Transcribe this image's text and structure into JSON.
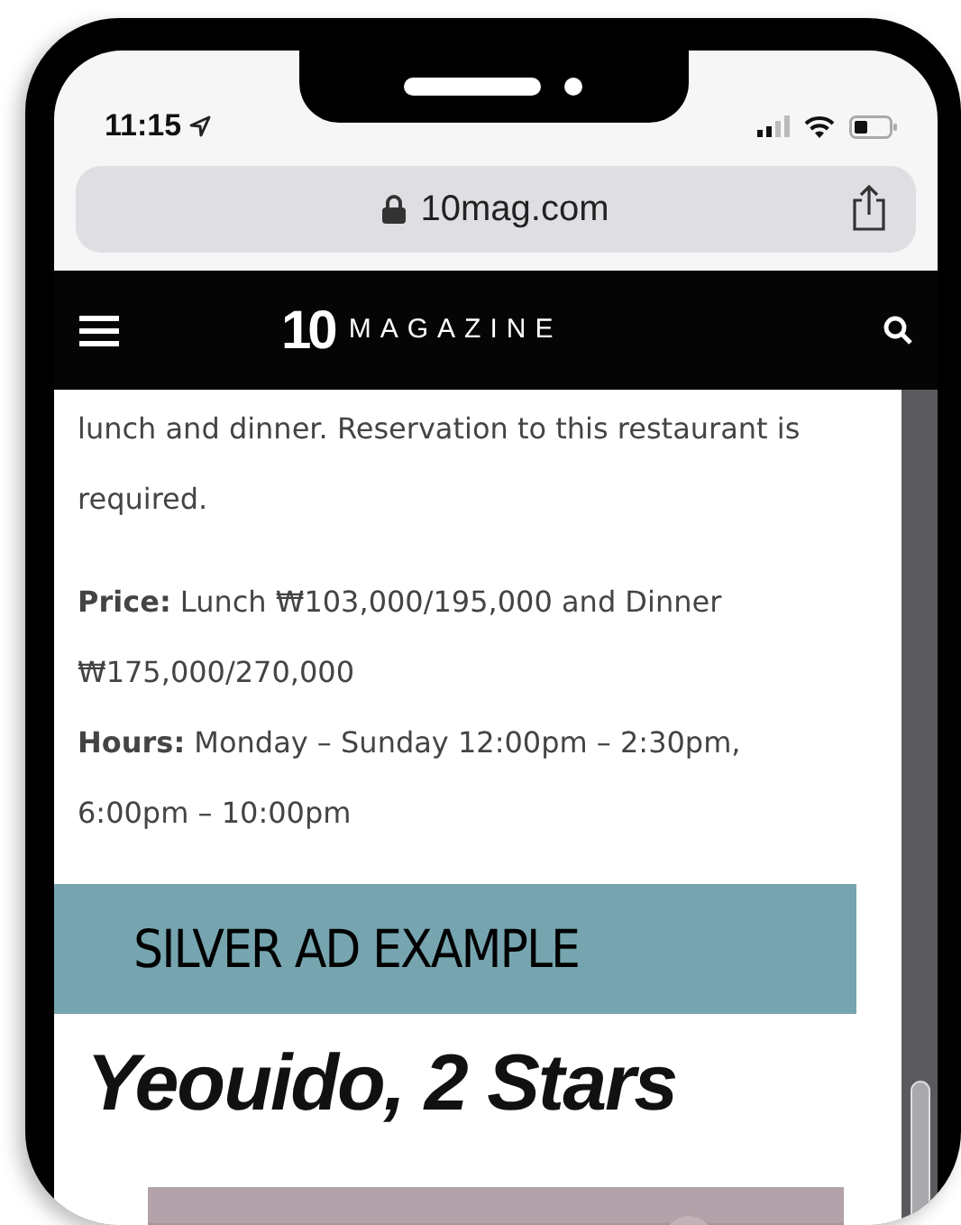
{
  "status_bar": {
    "time": "11:15"
  },
  "address_bar": {
    "url": "10mag.com"
  },
  "site_header": {
    "logo_mark": "10",
    "logo_text": "MAGAZINE"
  },
  "article": {
    "paragraphs": [
      "lunch and dinner. Reservation to this restaurant is required.",
      "**Price:** Lunch ₩103,000/195,000 and Dinner ₩175,000/270,000\n**Hours:** Monday – Sunday 12:00pm – 2:30pm, 6:00pm – 10:00pm"
    ]
  },
  "ad_banner": {
    "text": "SILVER AD EXAMPLE"
  },
  "heading": "Yeouido, 2 Stars"
}
